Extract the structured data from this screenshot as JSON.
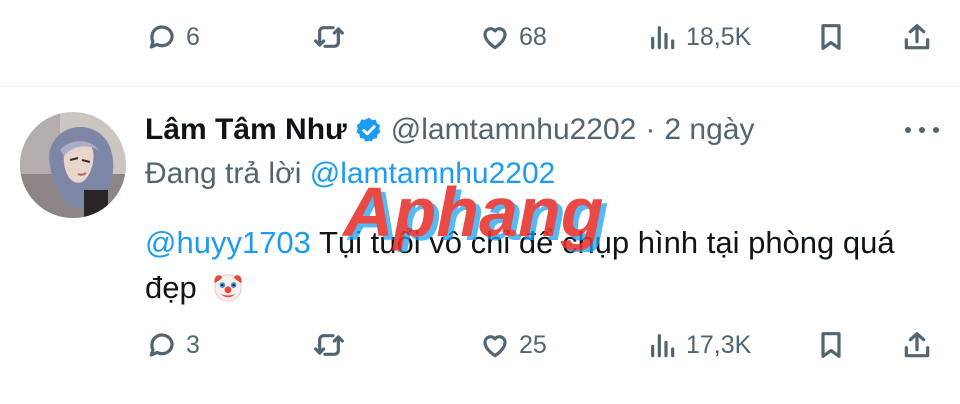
{
  "top_actions": {
    "reply_count": "6",
    "like_count": "68",
    "views_count": "18,5K"
  },
  "tweet": {
    "author_name": "Lâm Tâm Như",
    "author_handle": "@lamtamnhu2202",
    "separator": "·",
    "time_ago": "2 ngày",
    "replying_prefix": "Đang trả lời",
    "replying_to": "@lamtamnhu2202",
    "mention": "@huyy1703",
    "text": "Tụi tuổi vô chỉ để chụp hình tại phòng quá đẹp",
    "emoji": "clown-face",
    "actions": {
      "reply_count": "3",
      "like_count": "25",
      "views_count": "17,3K"
    }
  },
  "watermark": {
    "text": "Aphang",
    "color": "#e8322c",
    "shadow": "#1da1f2"
  },
  "colors": {
    "accent": "#1d9bf0",
    "muted": "#536471",
    "text": "#0f1419"
  }
}
